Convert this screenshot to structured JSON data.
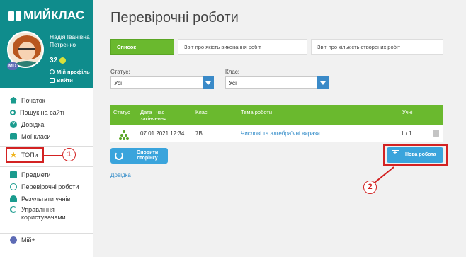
{
  "sidebar": {
    "logo": "МИЙКЛАС",
    "user_name": "Надія Іванівна Петренко",
    "coins": "32",
    "avatar_badge": "MD",
    "profile_link": "Мій профіль",
    "logout_link": "Вийти",
    "nav_top": [
      {
        "label": "Початок",
        "icon": "home-icon"
      },
      {
        "label": "Пошук на сайті",
        "icon": "search-icon"
      },
      {
        "label": "Довідка",
        "icon": "help-icon"
      },
      {
        "label": "Мої класи",
        "icon": "classes-icon"
      }
    ],
    "top_item": {
      "label": "ТОПи",
      "icon": "star-icon"
    },
    "nav_bottom": [
      {
        "label": "Предмети",
        "icon": "subjects-icon"
      },
      {
        "label": "Перевірочні роботи",
        "icon": "check-icon"
      },
      {
        "label": "Результати учнів",
        "icon": "results-icon"
      },
      {
        "label": "Управління користувачами",
        "icon": "manage-icon"
      }
    ],
    "my_plus": {
      "label": "Мій+",
      "icon": "my-plus-icon"
    }
  },
  "main": {
    "title": "Перевірочні роботи",
    "tabs": [
      {
        "label": "Список",
        "active": true
      },
      {
        "label": "Звіт про якість виконання робіт",
        "active": false
      },
      {
        "label": "Звіт про кількість створених робіт",
        "active": false
      }
    ],
    "filters": {
      "status_label": "Статус:",
      "status_value": "Усі",
      "class_label": "Клас:",
      "class_value": "Усі"
    },
    "table": {
      "headers": [
        "Статус",
        "Дата і час закінчення",
        "Клас",
        "Тема роботи",
        "Учні"
      ],
      "rows": [
        {
          "date": "07.01.2021 12:34",
          "class": "7В",
          "topic": "Числові та алгебраїчні вирази",
          "students": "1 / 1"
        }
      ]
    },
    "refresh_button": "Оновити сторінку",
    "new_button": "Нова робота",
    "help_link": "Довідка"
  },
  "annotations": {
    "marker_1": "1",
    "marker_2": "2",
    "color": "#d32222"
  },
  "colors": {
    "sidebar_header": "#0f8c8c",
    "accent_green": "#6ab92e",
    "button_blue": "#3aa4dc",
    "select_arrow": "#3a8ac8"
  }
}
